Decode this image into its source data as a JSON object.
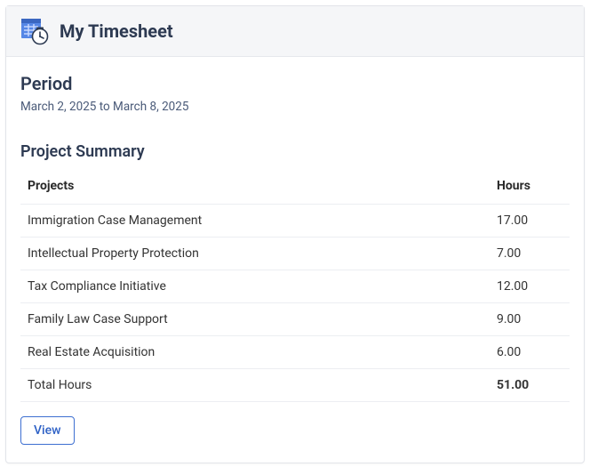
{
  "header": {
    "title": "My Timesheet",
    "icon": "timesheet-icon"
  },
  "period": {
    "label": "Period",
    "range": "March 2, 2025 to March 8, 2025"
  },
  "summary": {
    "title": "Project Summary",
    "columns": {
      "projects": "Projects",
      "hours": "Hours"
    },
    "rows": [
      {
        "project": "Immigration Case Management",
        "hours": "17.00"
      },
      {
        "project": "Intellectual Property Protection",
        "hours": "7.00"
      },
      {
        "project": "Tax Compliance Initiative",
        "hours": "12.00"
      },
      {
        "project": "Family Law Case Support",
        "hours": "9.00"
      },
      {
        "project": "Real Estate Acquisition",
        "hours": "6.00"
      }
    ],
    "totalLabel": "Total Hours",
    "totalHours": "51.00"
  },
  "actions": {
    "viewLabel": "View"
  }
}
